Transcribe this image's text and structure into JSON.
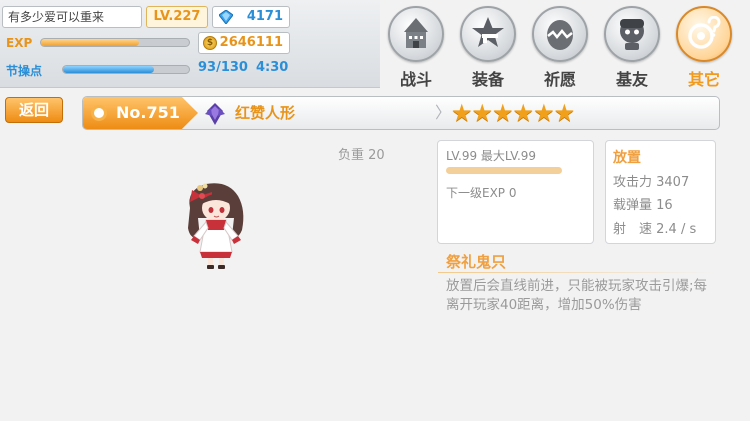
{
  "player": {
    "name": "有多少爱可以重来",
    "level": "LV.227",
    "gems": "4171",
    "exp_label": "EXP",
    "exp_progress": 0.66,
    "gold": "2646111",
    "stamina_label": "节操点",
    "stamina_progress": 0.72,
    "stamina_value": "93/130",
    "stamina_timer": "4:30"
  },
  "nav": {
    "items": [
      {
        "label": "战斗",
        "icon": "castle-icon"
      },
      {
        "label": "装备",
        "icon": "star-gun-icon"
      },
      {
        "label": "祈愿",
        "icon": "egg-icon"
      },
      {
        "label": "基友",
        "icon": "friend-icon"
      },
      {
        "label": "其它",
        "icon": "other-icon"
      }
    ],
    "active_index": 4
  },
  "header": {
    "back_label": "返回",
    "number": "No.751",
    "name": "红赞人形",
    "stars": "★★★★★★"
  },
  "detail": {
    "weight": "负重 20",
    "level_text": "LV.99 最大LV.99",
    "next_exp": "下一级EXP 0",
    "stat_type": "放置",
    "attack": "攻击力 3407",
    "ammo": "载弹量 16",
    "fire_rate": "射　速 2.4 / s",
    "skill_name": "祭礼鬼只",
    "skill_desc": "放置后会直线前进，只能被玩家攻击引爆;每离开玩家40距离，增加50%伤害"
  },
  "colors": {
    "accent_orange": "#ee8c14",
    "accent_blue": "#2b8fd8"
  }
}
